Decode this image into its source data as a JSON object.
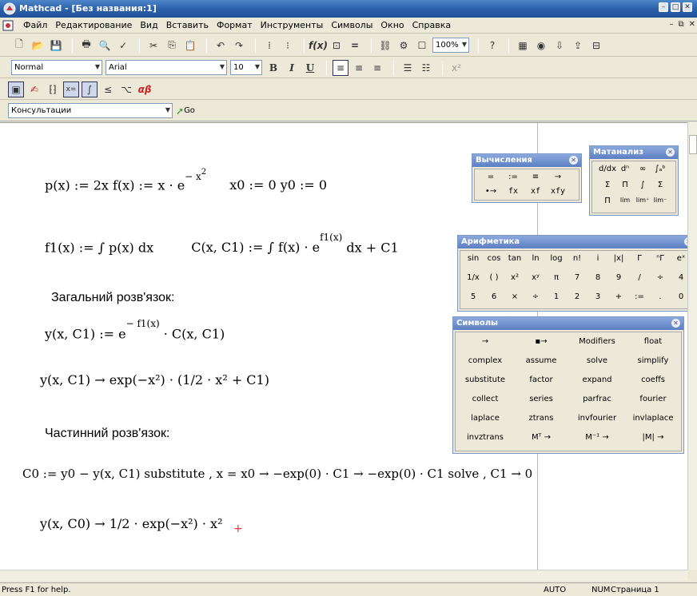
{
  "window": {
    "title": "Mathcad - [Без названия:1]"
  },
  "menu": [
    "Файл",
    "Редактирование",
    "Вид",
    "Вставить",
    "Формат",
    "Инструменты",
    "Символы",
    "Окно",
    "Справка"
  ],
  "toolbar": {
    "zoom": "100%",
    "style": "Normal",
    "font": "Arial",
    "size": "10",
    "bold": "B",
    "italic": "I",
    "underline": "U",
    "resources": "Консультации",
    "go": "Go"
  },
  "worksheet": {
    "line1": "p(x) := 2x    f(x) := x · e",
    "line1_exp": "− x",
    "line1_rest": "x0 := 0      y0 := 0",
    "line2": "f1(x) :=  ∫  p(x) dx",
    "line2b": "C(x, C1) :=  ∫  f(x) · e",
    "line2b_exp": "f1(x)",
    "line2b_rest": "dx + C1",
    "heading1": "Загальний розв'язок:",
    "line3": "y(x, C1) := e",
    "line3_exp": "− f1(x)",
    "line3_rest": "· C(x, C1)",
    "line4": "y(x, C1) → exp(−x²) · (1/2 · x² + C1)",
    "heading2": "Частинний розв'язок:",
    "line5": "C0 := y0 − y(x, C1) substitute , x = x0  → −exp(0) · C1 → −exp(0) · C1  solve , C1  → 0",
    "line6": "y(x, C0) → 1/2 · exp(−x²) · x²"
  },
  "palettes": {
    "calc": {
      "title": "Вычисления",
      "row1": [
        "=",
        ":=",
        "≡",
        "→"
      ],
      "row2": [
        "•→",
        "fx",
        "xf",
        "xfy"
      ]
    },
    "calculus": {
      "title": "Матанализ"
    },
    "arith": {
      "title": "Арифметика",
      "row1": [
        "sin",
        "cos",
        "tan",
        "ln",
        "log",
        "n!",
        "i",
        "|x|",
        "Γ",
        "ⁿΓ",
        "eˣ"
      ],
      "row2": [
        "1/x",
        "( )",
        "x²",
        "xʸ",
        "π",
        "7",
        "8",
        "9",
        "/",
        "÷",
        "4"
      ],
      "row3": [
        "5",
        "6",
        "×",
        "÷",
        "1",
        "2",
        "3",
        "+",
        ":=",
        ".",
        "0"
      ]
    },
    "symbols": {
      "title": "Символы",
      "cells": [
        [
          "→",
          "▪→",
          "Modifiers",
          "float"
        ],
        [
          "complex",
          "assume",
          "solve",
          "simplify"
        ],
        [
          "substitute",
          "factor",
          "expand",
          "coeffs"
        ],
        [
          "collect",
          "series",
          "parfrac",
          "fourier"
        ],
        [
          "laplace",
          "ztrans",
          "invfourier",
          "invlaplace"
        ],
        [
          "invztrans",
          "Mᵀ →",
          "M⁻¹ →",
          "|M| →"
        ]
      ]
    }
  },
  "status": {
    "help": "Press F1 for help.",
    "mode": "AUTO",
    "num": "NUM",
    "page": "Страница 1"
  }
}
